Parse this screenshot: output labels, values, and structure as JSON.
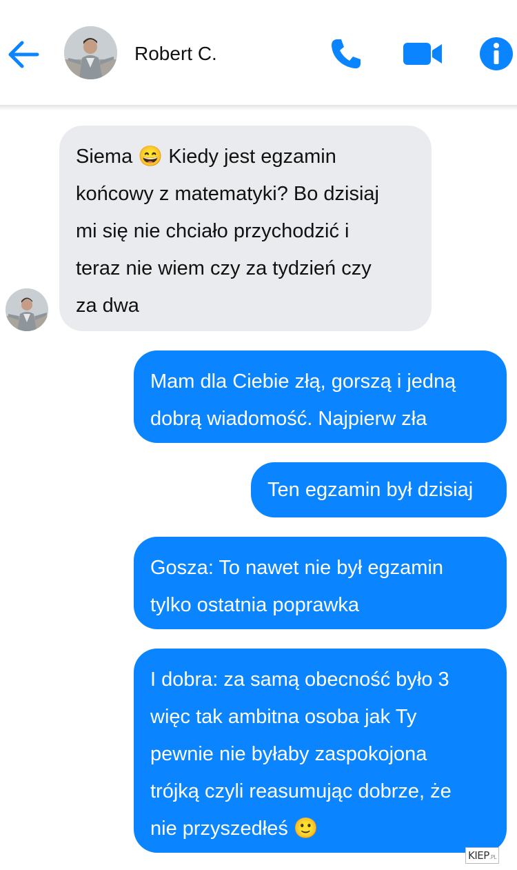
{
  "header": {
    "contact_name": "Robert C.",
    "icons": [
      "back-arrow-icon",
      "phone-icon",
      "video-icon",
      "info-icon"
    ],
    "accent": "#0a84ff"
  },
  "messages": [
    {
      "direction": "in",
      "text": "Siema 😄 Kiedy jest egzamin\nkońcowy z matematyki? Bo dzisiaj\nmi się nie chciało przychodzić i\nteraz nie wiem czy za tydzień czy\nza dwa"
    },
    {
      "direction": "out",
      "text": "Mam dla Ciebie złą, gorszą i jedną\ndobrą wiadomość. Najpierw zła"
    },
    {
      "direction": "out",
      "text": "Ten egzamin był dzisiaj"
    },
    {
      "direction": "out",
      "text": "Gosza: To nawet nie był egzamin\ntylko ostatnia poprawka"
    },
    {
      "direction": "out",
      "text": "I dobra: za samą obecność było 3\nwięc tak ambitna osoba jak Ty\npewnie nie byłaby zaspokojona\ntrójką czyli reasumując dobrze, że\nnie przyszedłeś 🙂"
    }
  ],
  "colors": {
    "incoming_bubble": "#e9ebee",
    "outgoing_bubble": "#0a84ff"
  },
  "watermark": {
    "main": "KIEP",
    "suffix": ".PL"
  }
}
